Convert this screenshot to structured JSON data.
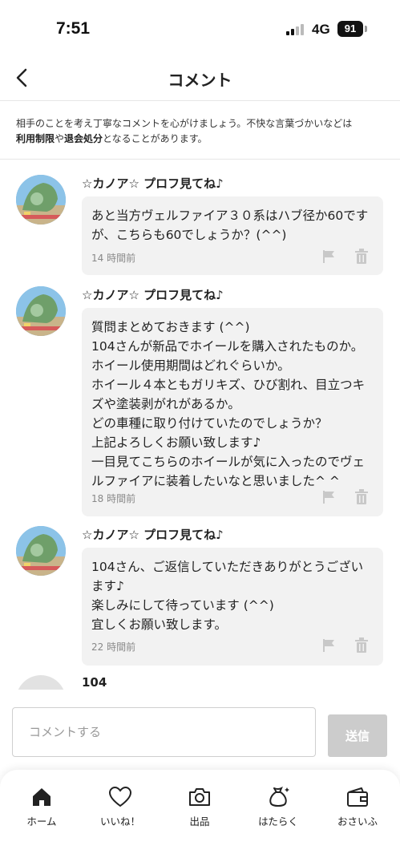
{
  "status_bar": {
    "time": "7:51",
    "network": "4G",
    "battery": "91"
  },
  "header": {
    "title": "コメント"
  },
  "notice": {
    "line1": "相手のことを考え丁寧なコメントを心がけましょう。不快な言葉づかいなどは",
    "bold1": "利用制限",
    "mid": "や",
    "bold2": "退会処分",
    "tail": "となることがあります。"
  },
  "comments": [
    {
      "name": "☆カノア☆ プロフ見てね♪",
      "text": "あと当方ヴェルファイア３０系はハブ径か60ですが、こちらも60でしょうか？(^^)",
      "time": "14 時間前"
    },
    {
      "name": "☆カノア☆ プロフ見てね♪",
      "text": "質問まとめておきます (^^)\n104さんが新品でホイールを購入されたものか。\nホイール使用期間はどれぐらいか。\nホイール４本ともガリキズ、ひび割れ、目立つキズや塗装剥がれがあるか。\nどの車種に取り付けていたのでしょうか？\n上記よろしくお願い致します♪\n一目見てこちらのホイールが気に入ったのでヴェルファイアに装着したいなと思いました^ ^",
      "time": "18 時間前"
    },
    {
      "name": "☆カノア☆ プロフ見てね♪",
      "text": "104さん、ご返信していただきありがとうございます♪\n楽しみにして待っています (^^)\n宜しくお願い致します。",
      "time": "22 時間前"
    },
    {
      "name": "104"
    }
  ],
  "composer": {
    "placeholder": "コメントする",
    "send_label": "送信"
  },
  "tabs": [
    {
      "label": "ホーム",
      "icon": "home-icon"
    },
    {
      "label": "いいね！",
      "icon": "heart-icon"
    },
    {
      "label": "出品",
      "icon": "camera-icon"
    },
    {
      "label": "はたらく",
      "icon": "money-bag-icon"
    },
    {
      "label": "おさいふ",
      "icon": "wallet-icon"
    }
  ],
  "colors": {
    "accent": "#222222",
    "send_disabled": "#cccccc",
    "bubble": "#f2f2f2"
  }
}
